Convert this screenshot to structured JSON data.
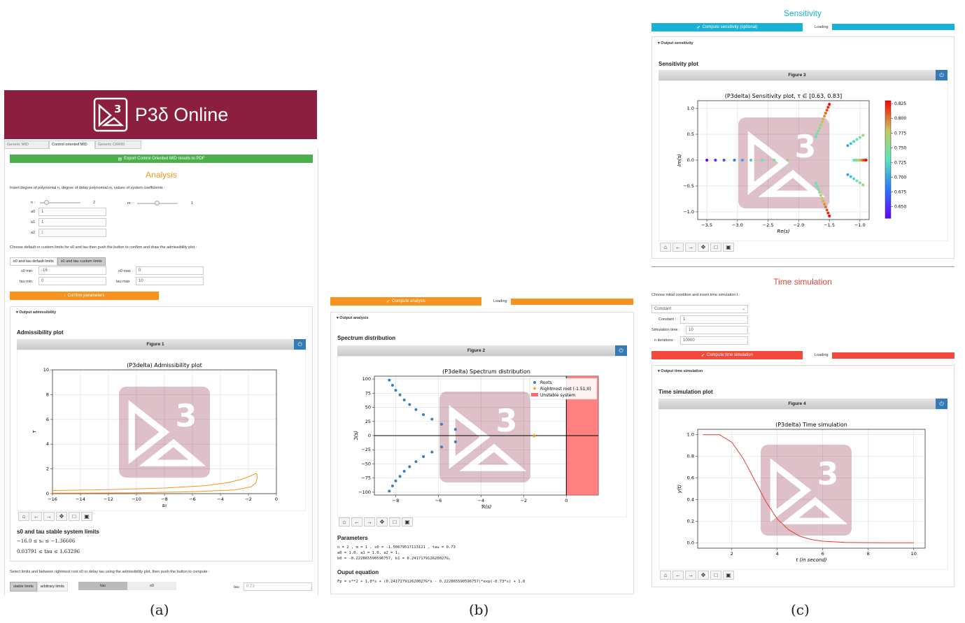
{
  "colors": {
    "banner": "#8c1f3f",
    "analysis_heading": "#f7931e",
    "sensitivity_heading": "#17b2d6",
    "time_heading": "#e8443a",
    "orange_curve": "#f7931e",
    "root_blue": "#3b7dc0",
    "unstable_red": "#ff6b6b"
  },
  "panel_a": {
    "brand": "P3δ Online",
    "tabs": [
      "Generic MID",
      "Control oriented MID",
      "Generic CRRID"
    ],
    "export_btn": "Export Control Oriented MID results to PDF",
    "heading": "Analysis",
    "instr1": "Insert degree of polynomial n, degree of delay polynomial m, values of system coefficients :",
    "n_label": "n :",
    "n_value": "2",
    "m_label": "m :",
    "m_value": "1",
    "a0_label": "a0",
    "a0_value": "1",
    "a1_label": "a1",
    "a1_value": "1",
    "a2_label": "a2",
    "a2_value": "1",
    "instr2": "Choose default or custom limits for s0 and tau then push the button to confirm and draw the admissibility plot :",
    "limit_tabs": [
      "s0 and tau default limits",
      "s0 and tau custom limits"
    ],
    "s0min_label": "s0 min",
    "s0min_value": "-16",
    "s0max_label": "s0 max",
    "s0max_value": "0",
    "taumin_label": "tau min",
    "taumin_value": "0",
    "taumax_label": "tau max",
    "taumax_value": "10",
    "confirm_btn": "Confirm parameters",
    "output_toggle": "Output admissibility",
    "plot_title": "Admissibility plot",
    "fig_label": "Figure 1",
    "stable_title": "s0 and tau stable system limits",
    "stable_line1": "−16.0 ≤ s₀ ≤ −1.36606",
    "stable_line2": "0.03791 ≤ tau ≤ 1.63296",
    "instr3": "Select limits and between rightmost root s0 or delay tau using the admissibility plot, then push the button to compute :",
    "bottom_tabs": [
      "stable limits",
      "arbitrary limits"
    ],
    "bottom_tabs2": [
      "tau",
      "s0"
    ],
    "tau_label": "tau",
    "tau_value": "0.73"
  },
  "panel_b": {
    "compute_btn": "Compute analysis",
    "loading": "Loading",
    "output_toggle": "Output analysis",
    "plot_title": "Spectrum distribution",
    "fig_label": "Figure 2",
    "params_title": "Parameters",
    "params_line1": "n =  2 , m =  1 , s0 =  -1.50679517113121 , tau =  0.73",
    "params_line2": "a0 = 1.0, a1 = 1.0, a2 = 1,",
    "params_line3": "b0 = -0.222865590596757, b1 = 0.241717912620027G,",
    "eq_title": "Ouput equation",
    "eq_line": "Fp =  s**2 + 1.0*s + (0.241717912620027G*s - 0.222865590596757)*exp(-0.73*s) + 1.0"
  },
  "panel_c": {
    "sens_heading": "Sensitivity",
    "sens_btn": "Compute sensitivity (optional)",
    "loading": "Loading",
    "sens_toggle": "Output sensitivity",
    "sens_plot_title": "Sensitivity plot",
    "fig3_label": "Figure 3",
    "time_heading": "Time simulation",
    "time_instr": "Choose initial condition and insert time simulation t :",
    "select_value": "Constant",
    "const_label": "Constant :",
    "const_value": "1",
    "simtime_label": "Simulation time :",
    "simtime_value": "10",
    "iter_label": "n iterations :",
    "iter_value": "10000",
    "time_btn": "Compute time simulation",
    "time_toggle": "Output time simulation",
    "time_plot_title": "Time simulation plot",
    "fig4_label": "Figure 4"
  },
  "captions": [
    "(a)",
    "(b)",
    "(c)"
  ],
  "chart_data": [
    {
      "type": "line",
      "title": "(P3delta) Admissibility plot",
      "xlabel": "s₀",
      "ylabel": "τ",
      "xlim": [
        -16,
        0
      ],
      "ylim": [
        0,
        10
      ],
      "xticks": [
        "−16",
        "−14",
        "−12",
        "−10",
        "−8",
        "−6",
        "−4",
        "−2",
        "0"
      ],
      "yticks": [
        "0",
        "2",
        "4",
        "6",
        "8",
        "10"
      ],
      "series": [
        {
          "x": [
            -16,
            -12,
            -8,
            -5,
            -3.5,
            -2.5,
            -1.8,
            -1.5,
            -1.4,
            -1.37,
            -1.45,
            -1.8,
            -3,
            -6,
            -10,
            -16
          ],
          "y": [
            0.25,
            0.33,
            0.45,
            0.65,
            0.88,
            1.15,
            1.45,
            1.62,
            1.6,
            1.3,
            0.9,
            0.55,
            0.3,
            0.15,
            0.07,
            0.04
          ]
        }
      ]
    },
    {
      "type": "scatter",
      "title": "(P3delta) Spectrum distribution",
      "xlabel": "ℜ(s)",
      "ylabel": "ℑ(s)",
      "xlim": [
        -9,
        1.5
      ],
      "ylim": [
        -105,
        105
      ],
      "xticks": [
        "−8",
        "−6",
        "−4",
        "−2",
        "0"
      ],
      "yticks": [
        "−100",
        "−75",
        "−50",
        "−25",
        "0",
        "25",
        "50",
        "75",
        "100"
      ],
      "legend": [
        "Roots",
        "Rightmost root (-1.51;0)",
        "Unstable system"
      ],
      "series": [
        {
          "name": "Roots",
          "x": [
            -8.3,
            -8.15,
            -8.0,
            -7.8,
            -7.6,
            -7.35,
            -7.05,
            -6.7,
            -6.3,
            -5.85,
            -5.2,
            -5.2,
            -5.85,
            -6.3,
            -6.7,
            -7.05,
            -7.35,
            -7.6,
            -7.8,
            -8.0,
            -8.15,
            -8.3
          ],
          "y": [
            98,
            89,
            80,
            72,
            63,
            55,
            46,
            37,
            29,
            20,
            11,
            -11,
            -20,
            -29,
            -37,
            -46,
            -55,
            -63,
            -72,
            -80,
            -89,
            -98
          ]
        },
        {
          "name": "Rightmost root (-1.51;0)",
          "x": [
            -1.51
          ],
          "y": [
            0
          ]
        }
      ]
    },
    {
      "type": "scatter",
      "title": "(P3delta) Sensitivity plot, τ ∈ [0.63, 0.83]",
      "xlabel": "Re(s)",
      "ylabel": "Im(s)",
      "xlim": [
        -3.65,
        -0.85
      ],
      "ylim": [
        -1.15,
        1.15
      ],
      "xticks": [
        "−3.5",
        "−3.0",
        "−2.5",
        "−2.0",
        "−1.5",
        "−1.0"
      ],
      "yticks": [
        "−1.0",
        "−0.5",
        "0.0",
        "0.5",
        "1.0"
      ],
      "colorbar_ticks": [
        "0.650",
        "0.675",
        "0.700",
        "0.725",
        "0.750",
        "0.775",
        "0.800",
        "0.825"
      ]
    },
    {
      "type": "line",
      "title": "(P3delta) Time simulation",
      "xlabel": "t (in second)",
      "ylabel": "y(t)",
      "xlim": [
        0.5,
        10.5
      ],
      "ylim": [
        -0.05,
        1.05
      ],
      "xticks": [
        "2",
        "4",
        "6",
        "8",
        "10"
      ],
      "yticks": [
        "0.0",
        "0.2",
        "0.4",
        "0.6",
        "0.8",
        "1.0"
      ],
      "series": [
        {
          "x": [
            0.73,
            1.46,
            2,
            2.5,
            3,
            3.5,
            4,
            4.5,
            5,
            5.5,
            6,
            7,
            8,
            10
          ],
          "y": [
            1,
            1,
            0.93,
            0.78,
            0.58,
            0.38,
            0.22,
            0.12,
            0.06,
            0.03,
            0.015,
            0.004,
            0.001,
            0
          ]
        }
      ]
    }
  ]
}
